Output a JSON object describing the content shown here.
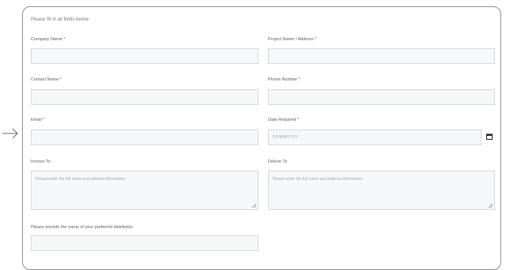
{
  "form": {
    "intro": "Please fill in all fields below.",
    "company_name_label": "Company Name *",
    "project_name_label": "Project Name / Address *",
    "contact_name_label": "Contact Name *",
    "phone_number_label": "Phone Number *",
    "email_label": "Email *",
    "date_required_label": "Date Required *",
    "date_placeholder": "DD/MM/YYYY",
    "invoice_to_label": "Invoice To",
    "invoice_to_placeholder": "Please enter the full name and address information.",
    "deliver_to_label": "Deliver To",
    "deliver_to_placeholder": "Please enter the full name and address information.",
    "distributor_label": "Please provide the name of your preferred distributor."
  },
  "icons": {
    "arrow": "arrow-right-icon",
    "calendar": "calendar-icon",
    "resize": "resize-handle-icon"
  },
  "colors": {
    "field_bg": "#f6f7f8",
    "field_border": "#d6d9dc",
    "card_border": "#8f8f8f"
  }
}
